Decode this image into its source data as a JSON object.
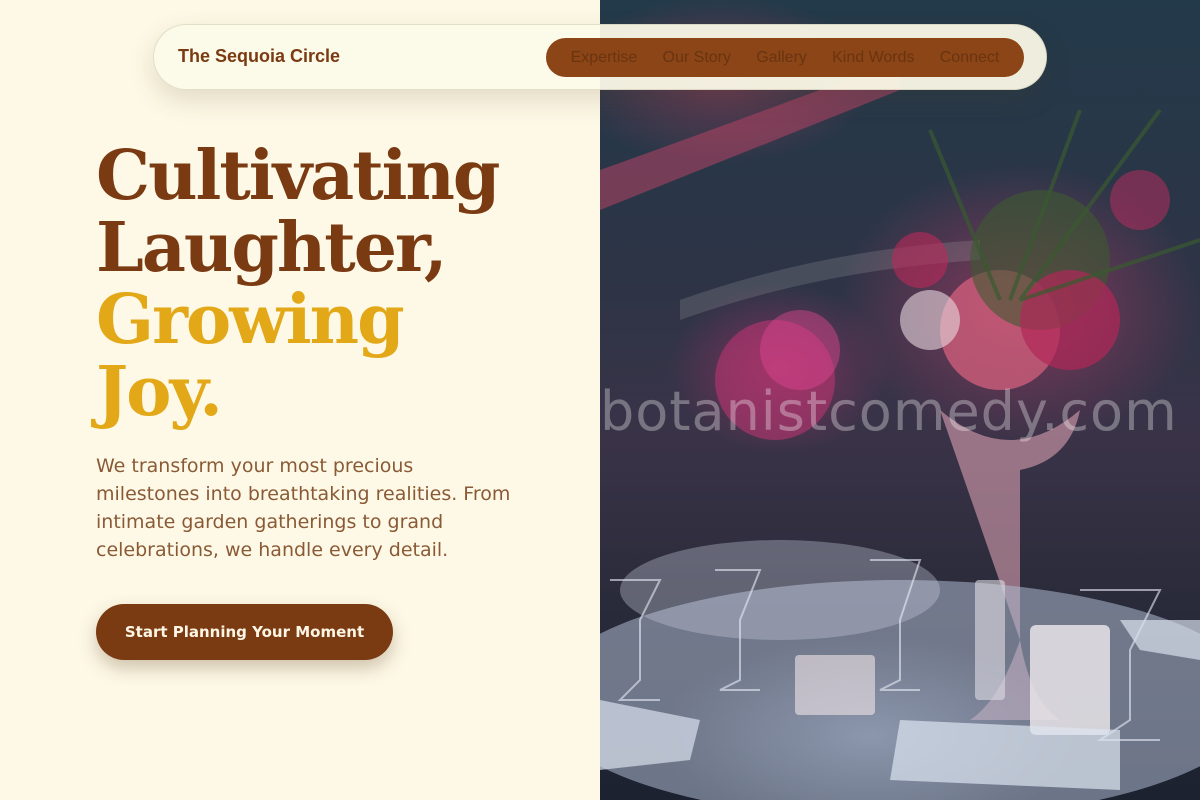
{
  "brand": {
    "name": "The Sequoia Circle"
  },
  "nav": {
    "items": [
      "Expertise",
      "Our Story",
      "Gallery",
      "Kind Words",
      "Connect"
    ]
  },
  "hero": {
    "line1": "Cultivating",
    "line2": "Laughter,",
    "line3": "Growing",
    "line4": "Joy.",
    "lead": "We transform your most precious milestones into breathtaking realities. From intimate garden gatherings to grand celebrations, we handle every detail.",
    "cta": "Start Planning Your Moment"
  },
  "image": {
    "watermark": "botanistcomedy.com"
  },
  "colors": {
    "background": "#fdf9e6",
    "brown": "#7a3a12",
    "gold": "#e2a818",
    "menu_pill": "#8b4516"
  }
}
